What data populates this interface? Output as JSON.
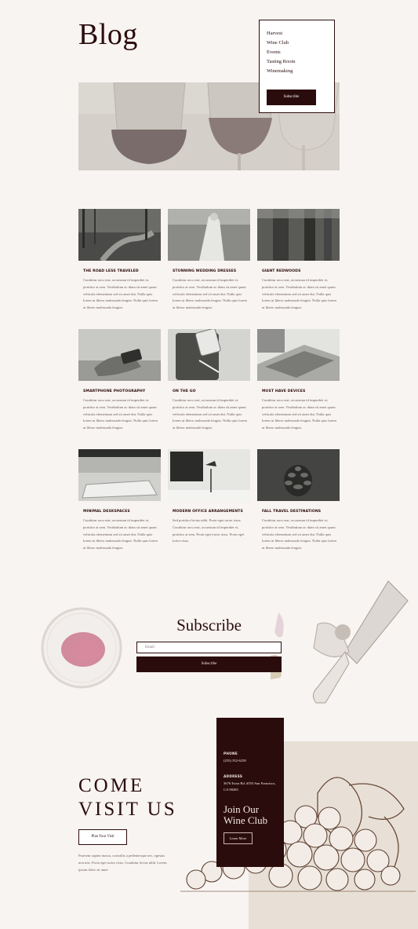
{
  "page": {
    "title": "Blog"
  },
  "menu": {
    "items": [
      "Harvest",
      "Wine Club",
      "Events",
      "Tasting Room",
      "Winemaking"
    ],
    "subscribe_label": "Subscribe"
  },
  "posts": [
    {
      "title": "THE ROAD LESS TRAVELED",
      "excerpt": "Curabitur arcu erat, accumsan id imperdiet et, porttitor at sem. Vestibulum ac diam sit amet quam vehicula elementum sed sit amet dui. Nulla quis lorem ut libero malesuada feugiat. Nulla quis lorem ut libero malesuada feugiat."
    },
    {
      "title": "STUNNING WEDDING DRESSES",
      "excerpt": "Curabitur arcu erat, accumsan id imperdiet et, porttitor at sem. Vestibulum ac diam sit amet quam vehicula elementum sed sit amet dui. Nulla quis lorem ut libero malesuada feugiat. Nulla quis lorem ut libero malesuada feugiat."
    },
    {
      "title": "GIANT REDWOODS",
      "excerpt": "Curabitur arcu erat, accumsan id imperdiet et, porttitor at sem. Vestibulum ac diam sit amet quam vehicula elementum sed sit amet dui. Nulla quis lorem ut libero malesuada feugiat. Nulla quis lorem ut libero malesuada feugiat."
    },
    {
      "title": "SMARTPHONE PHOTOGRAPHY",
      "excerpt": "Curabitur arcu erat, accumsan id imperdiet et, porttitor at sem. Vestibulum ac diam sit amet quam vehicula elementum sed sit amet dui. Nulla quis lorem ut libero malesuada feugiat. Nulla quis lorem ut libero malesuada feugiat."
    },
    {
      "title": "ON THE GO",
      "excerpt": "Curabitur arcu erat, accumsan id imperdiet et, porttitor at sem. Vestibulum ac diam sit amet quam vehicula elementum sed sit amet dui. Nulla quis lorem ut libero malesuada feugiat. Nulla quis lorem ut libero malesuada feugiat."
    },
    {
      "title": "MUST HAVE DEVICES",
      "excerpt": "Curabitur arcu erat, accumsan id imperdiet et, porttitor at sem. Vestibulum ac diam sit amet quam vehicula elementum sed sit amet dui. Nulla quis lorem ut libero malesuada feugiat. Nulla quis lorem ut libero malesuada feugiat."
    },
    {
      "title": "MINIMAL DESKSPACES",
      "excerpt": "Curabitur arcu erat, accumsan id imperdiet et, porttitor at sem. Vestibulum ac diam sit amet quam vehicula elementum sed sit amet dui. Nulla quis lorem ut libero malesuada feugiat. Nulla quis lorem ut libero malesuada feugiat."
    },
    {
      "title": "MODERN OFFICE ARRANGEMENTS",
      "excerpt": "Sed porttitor lectus nibh. Proin eget tortor risus. Curabitur arcu erat, accumsan id imperdiet et, porttitor at sem. Proin eget tortor risus. Proin eget tortor risus."
    },
    {
      "title": "FALL TRAVEL DESTINATIONS",
      "excerpt": "Curabitur arcu erat, accumsan id imperdiet et, porttitor at sem. Vestibulum ac diam sit amet quam vehicula elementum sed sit amet dui. Nulla quis lorem ut libero malesuada feugiat. Nulla quis lorem ut libero malesuada feugiat."
    }
  ],
  "subscribe": {
    "title": "Subscribe",
    "email_placeholder": "Email",
    "button_label": "Subscribe"
  },
  "visit": {
    "heading_line1": "COME",
    "heading_line2": "VISIT US",
    "button_label": "Plan Your Visit",
    "text": "Praesent sapien massa, convallis a pellentesque nec, egestas non nisi. Proin eget tortor risus. Curabitur lectus nibh. Lorem ipsum dolor sit amet"
  },
  "club": {
    "phone_label": "PHONE",
    "phone": "(255) 352-6258",
    "address_label": "ADDRESS",
    "address": "3676 Extra Rd. #555 San Francisco, CA 98285",
    "join_line1": "Join Our",
    "join_line2": "Wine Club",
    "more_label": "Learn More"
  },
  "colors": {
    "accent": "#2b0c0c",
    "background": "#f8f4f1",
    "panel": "#e8e0d6"
  }
}
